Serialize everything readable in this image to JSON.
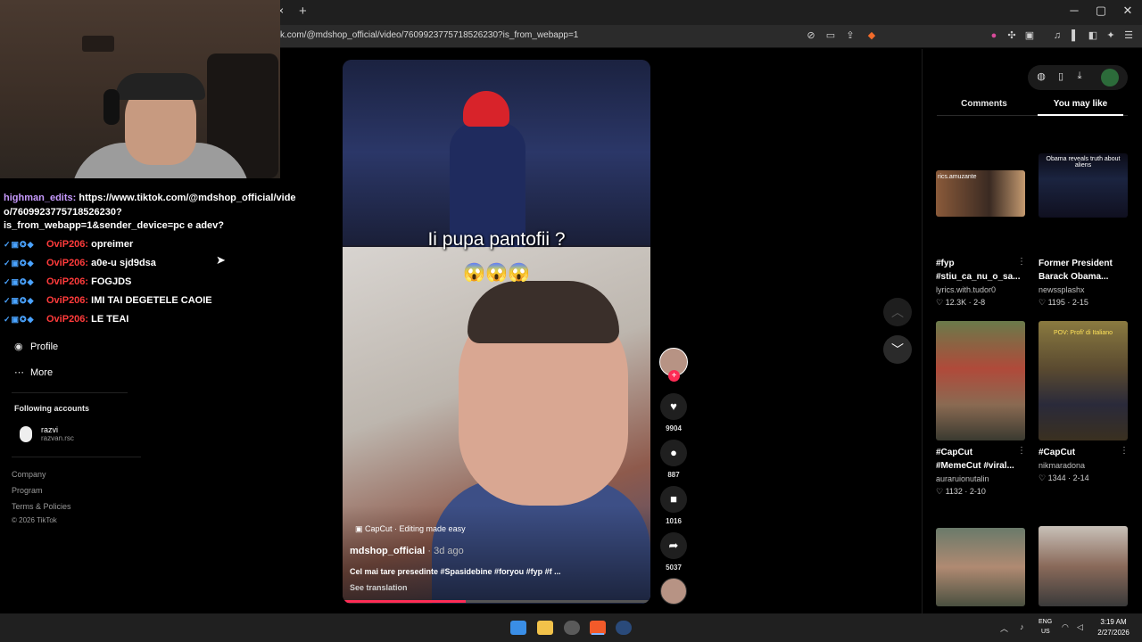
{
  "browser": {
    "url": "k.com/@mdshop_official/video/7609923775718526230?is_from_webapp=1",
    "tab_close": "×",
    "new_tab": "+",
    "minimize": "─",
    "maximize": "▢",
    "close": "✕"
  },
  "sidebar": {
    "profile_label": "Profile",
    "more_label": "More",
    "following_label": "Following accounts",
    "account_name": "razvi",
    "account_handle": "razvan.rsc",
    "footer": [
      "Company",
      "Program",
      "Terms & Policies",
      "© 2026 TikTok"
    ]
  },
  "chat": [
    {
      "user": "highman_edits:",
      "text": "https://www.tiktok.com/@mdshop_official/vide",
      "line2": "o/7609923775718526230?",
      "line3": "is_from_webapp=1&sender_device=pc e adev?"
    },
    {
      "user": "OviP206:",
      "text": "opreimer"
    },
    {
      "user": "OviP206:",
      "text": "a0e-u sjd9dsa"
    },
    {
      "user": "OviP206:",
      "text": "FOGJDS"
    },
    {
      "user": "OviP206:",
      "text": "IMI TAI DEGETELE CAOIE"
    },
    {
      "user": "OviP206:",
      "text": "LE TEAI"
    }
  ],
  "video": {
    "caption": "Ii pupa pantofii ?",
    "emoji": "😱😱😱",
    "capcut_label": "CapCut · Editing made easy",
    "author": "mdshop_official",
    "date": " · 3d ago",
    "description": "Cel mai tare presedinte #Spasidebine #foryou #fyp #f ...",
    "see_translation": "See translation",
    "progress_fraction": 0.4
  },
  "actions": {
    "likes": "9904",
    "comments": "887",
    "saves": "1016",
    "shares": "5037"
  },
  "right_panel": {
    "tab_comments": "Comments",
    "tab_you_may_like": "You may like",
    "videos": [
      {
        "thumb_text": "rics.amuzante",
        "title1": "#fyp",
        "title2": "#stiu_ca_nu_o_sa...",
        "author": "lyrics.with.tudor0",
        "stats": "♡ 12.3K · 2-8"
      },
      {
        "thumb_text": "Obama reveals truth about aliens",
        "title1": "Former President",
        "title2": "Barack Obama...",
        "author": "newssplashx",
        "stats": "♡ 1195 · 2-15"
      },
      {
        "thumb_text": "",
        "title1": "#CapCut",
        "title2": "#MemeCut #viral...",
        "author": "auraruionutalin",
        "stats": "♡ 1132 · 2-10"
      },
      {
        "thumb_text": "POV: Profi' di Italiano",
        "title1": "#CapCut",
        "title2": "",
        "author": "nikmaradona",
        "stats": "♡ 1344 · 2-14"
      }
    ]
  },
  "taskbar": {
    "time": "3:19 AM",
    "date": "2/27/2026",
    "lang1": "ENG",
    "lang2": "US"
  }
}
